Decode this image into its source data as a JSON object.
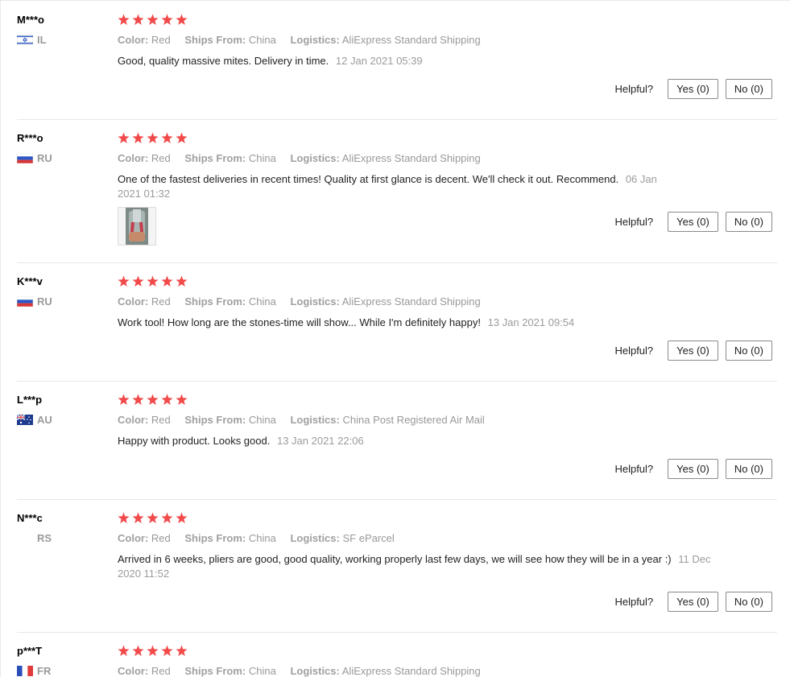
{
  "labels": {
    "color": "Color:",
    "ships_from": "Ships From:",
    "logistics": "Logistics:",
    "helpful": "Helpful?"
  },
  "colors": {
    "star": "#f24a4a",
    "muted": "#999999"
  },
  "reviews": [
    {
      "user": "M***o",
      "country": "IL",
      "flag_icon": "israel-flag-icon",
      "rating": 5,
      "color": "Red",
      "ships_from": "China",
      "logistics": "AliExpress Standard Shipping",
      "text": "Good, quality massive mites. Delivery in time.",
      "time": "12 Jan 2021 05:39",
      "yes": "Yes (0)",
      "no": "No (0)"
    },
    {
      "user": "R***o",
      "country": "RU",
      "flag_icon": "russia-flag-icon",
      "rating": 5,
      "color": "Red",
      "ships_from": "China",
      "logistics": "AliExpress Standard Shipping",
      "text": "One of the fastest deliveries in recent times! Quality at first glance is decent. We'll check it out. Recommend.",
      "time": "06 Jan 2021 01:32",
      "photo_icon": "pliers-photo-thumbnail",
      "yes": "Yes (0)",
      "no": "No (0)"
    },
    {
      "user": "K***v",
      "country": "RU",
      "flag_icon": "russia-flag-icon",
      "rating": 5,
      "color": "Red",
      "ships_from": "China",
      "logistics": "AliExpress Standard Shipping",
      "text": "Work tool! How long are the stones-time will show... While I'm definitely happy!",
      "time": "13 Jan 2021 09:54",
      "yes": "Yes (0)",
      "no": "No (0)"
    },
    {
      "user": "L***p",
      "country": "AU",
      "flag_icon": "australia-flag-icon",
      "rating": 5,
      "color": "Red",
      "ships_from": "China",
      "logistics": "China Post Registered Air Mail",
      "text": "Happy with product. Looks good.",
      "time": "13 Jan 2021 22:06",
      "yes": "Yes (0)",
      "no": "No (0)"
    },
    {
      "user": "N***c",
      "country": "RS",
      "rating": 5,
      "color": "Red",
      "ships_from": "China",
      "logistics": "SF eParcel",
      "text": "Arrived in 6 weeks, pliers are good, good quality, working properly last few days, we will see how they will be in a year :)",
      "time": "11 Dec 2020 11:52",
      "yes": "Yes (0)",
      "no": "No (0)"
    },
    {
      "user": "p***T",
      "country": "FR",
      "flag_icon": "france-flag-icon",
      "rating": 5,
      "color": "Red",
      "ships_from": "China",
      "logistics": "AliExpress Standard Shipping"
    }
  ]
}
